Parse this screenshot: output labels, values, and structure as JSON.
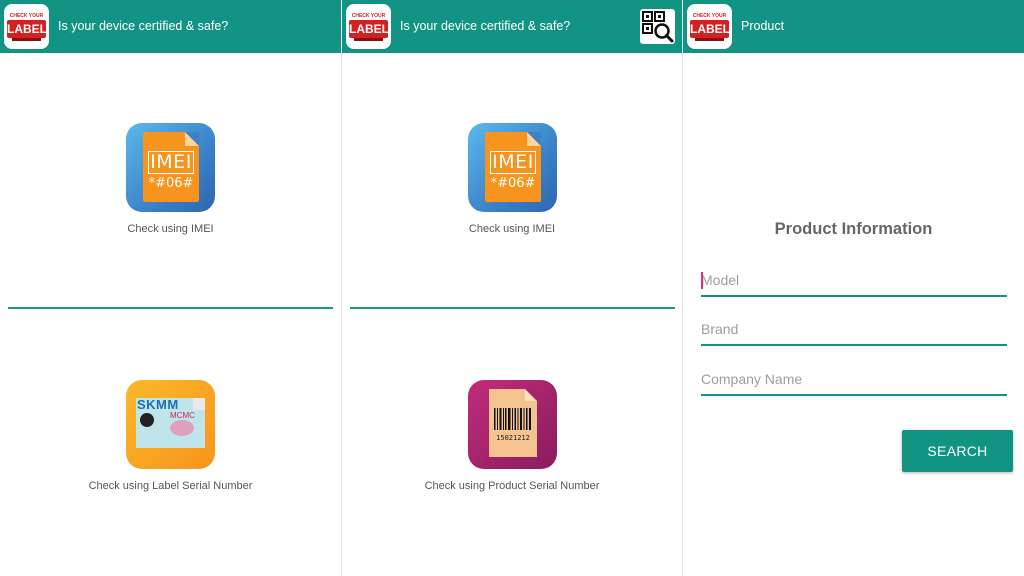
{
  "colors": {
    "appbar": "#119484",
    "accent": "#119484",
    "cursor": "#d0357a"
  },
  "app_logo": {
    "top": "CHECK YOUR",
    "main": "LABEL",
    "icon": "label-logo-icon"
  },
  "panel1": {
    "title": "Is your device certified & safe?",
    "imei_tile": {
      "line1": "IMEI",
      "line2": "*#06#",
      "caption": "Check using IMEI"
    },
    "label_tile": {
      "brand": "SKMM",
      "sub": "MCMC",
      "caption": "Check using Label Serial Number"
    }
  },
  "panel2": {
    "title": "Is your device certified & safe?",
    "qr_icon": "qr-search-icon",
    "imei_tile": {
      "line1": "IMEI",
      "line2": "*#06#",
      "caption": "Check using IMEI"
    },
    "product_tile": {
      "barcode_number": "15021212",
      "caption": "Check using Product Serial Number"
    }
  },
  "panel3": {
    "title": "Product",
    "heading": "Product Information",
    "fields": {
      "model": {
        "placeholder": "Model",
        "value": ""
      },
      "brand": {
        "placeholder": "Brand",
        "value": ""
      },
      "company": {
        "placeholder": "Company Name",
        "value": ""
      }
    },
    "search_label": "SEARCH"
  }
}
